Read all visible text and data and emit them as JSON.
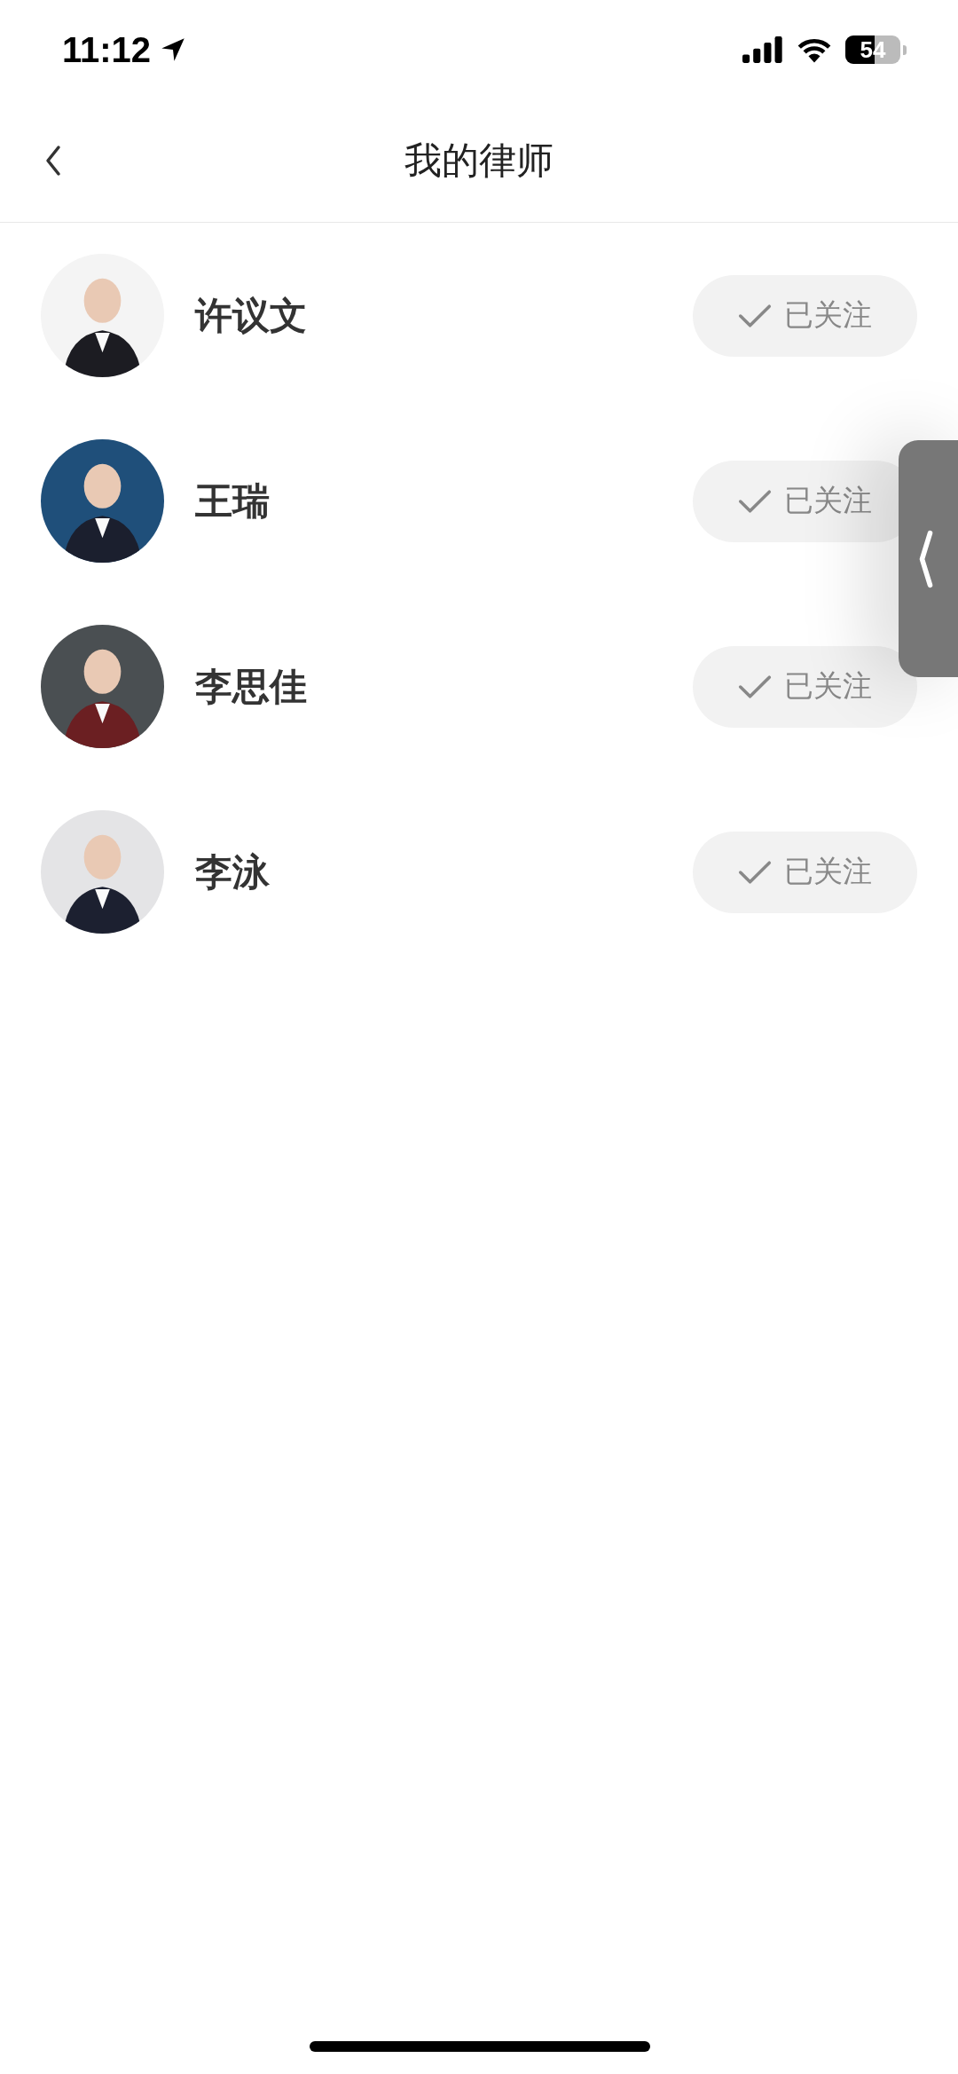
{
  "status_bar": {
    "time": "11:12",
    "battery": "54"
  },
  "nav": {
    "title": "我的律师"
  },
  "lawyers": [
    {
      "name": "许议文",
      "followed": true,
      "button_label": "已关注"
    },
    {
      "name": "王瑞",
      "followed": true,
      "button_label": "已关注"
    },
    {
      "name": "李思佳",
      "followed": true,
      "button_label": "已关注"
    },
    {
      "name": "李泳",
      "followed": true,
      "button_label": "已关注"
    }
  ]
}
